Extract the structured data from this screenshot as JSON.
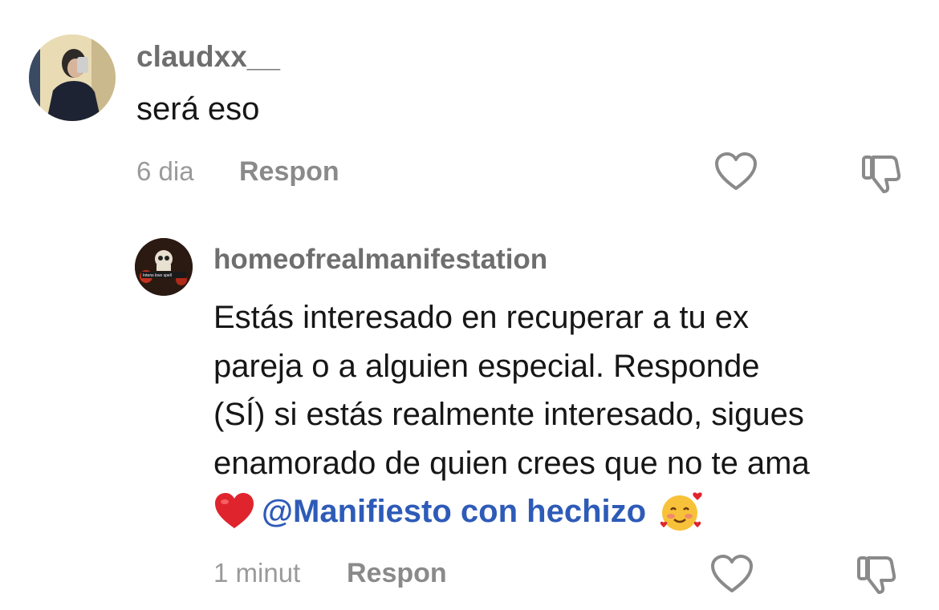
{
  "comments": [
    {
      "username": "claudxx__",
      "text": "será eso",
      "time": "6 dia",
      "reply_label": "Respon"
    },
    {
      "username": "homeofrealmanifestation",
      "avatar_caption": "Intens love spell",
      "text_lines": [
        "Estás interesado en recuperar a tu ex",
        "pareja o a alguien especial. Responde",
        "(SÍ) si estás realmente interesado, sigues",
        "enamorado de quien crees que no te ama"
      ],
      "heart_emoji": "❤️",
      "mention": "@Manifiesto con hechizo",
      "end_emoji": "🥰",
      "time": "1 minut",
      "reply_label": "Respon"
    }
  ],
  "colors": {
    "username": "#6e6e6e",
    "text": "#161616",
    "mention": "#2e5bb8",
    "meta": "#9a9a9a"
  }
}
